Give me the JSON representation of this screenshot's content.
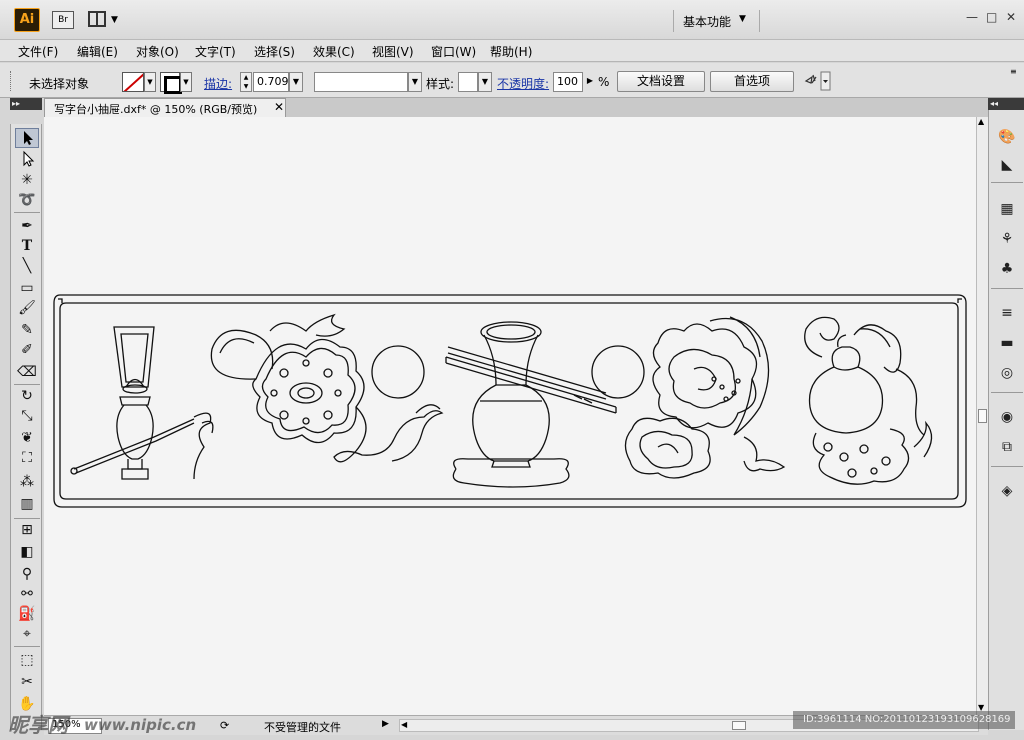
{
  "app": {
    "logo": "Ai",
    "bridge_label": "Br",
    "workspace": "基本功能",
    "window_controls": [
      "▭",
      "□",
      "✕"
    ]
  },
  "menu": [
    "文件(F)",
    "编辑(E)",
    "对象(O)",
    "文字(T)",
    "选择(S)",
    "效果(C)",
    "视图(V)",
    "窗口(W)",
    "帮助(H)"
  ],
  "control": {
    "selection_status": "未选择对象",
    "stroke_label": "描边:",
    "stroke_value": "0.709",
    "style_label": "样式:",
    "opacity_label": "不透明度:",
    "opacity_value": "100",
    "percent": "%",
    "doc_setup_button": "文档设置",
    "prefs_button": "首选项"
  },
  "document": {
    "tab_title": "写字台小抽屉.dxf* @ 150% (RGB/预览)",
    "close": "✕"
  },
  "status": {
    "zoom": "150%",
    "file_status": "不受管理的文件"
  },
  "watermark": {
    "brand": "昵享网",
    "url": "www.nipic.cn",
    "id_text": "ID:3961114 NO:20110123193109628169"
  },
  "colors": {
    "accent_orange": "#f7a21b",
    "link_blue": "#1a35a6",
    "canvas": "#f4f4f4"
  },
  "tools": [
    "selection-tool",
    "direct-selection-tool",
    "magic-wand-tool",
    "lasso-tool",
    "pen-tool",
    "type-tool",
    "line-tool",
    "rectangle-tool",
    "paintbrush-tool",
    "pencil-tool",
    "blob-brush-tool",
    "eraser-tool",
    "rotate-tool",
    "scale-tool",
    "warp-tool",
    "free-transform-tool",
    "symbol-sprayer-tool",
    "graph-tool",
    "mesh-tool",
    "gradient-tool",
    "eyedropper-tool",
    "blend-tool",
    "live-paint-tool",
    "live-paint-selection-tool",
    "artboard-tool",
    "slice-tool",
    "hand-tool"
  ]
}
